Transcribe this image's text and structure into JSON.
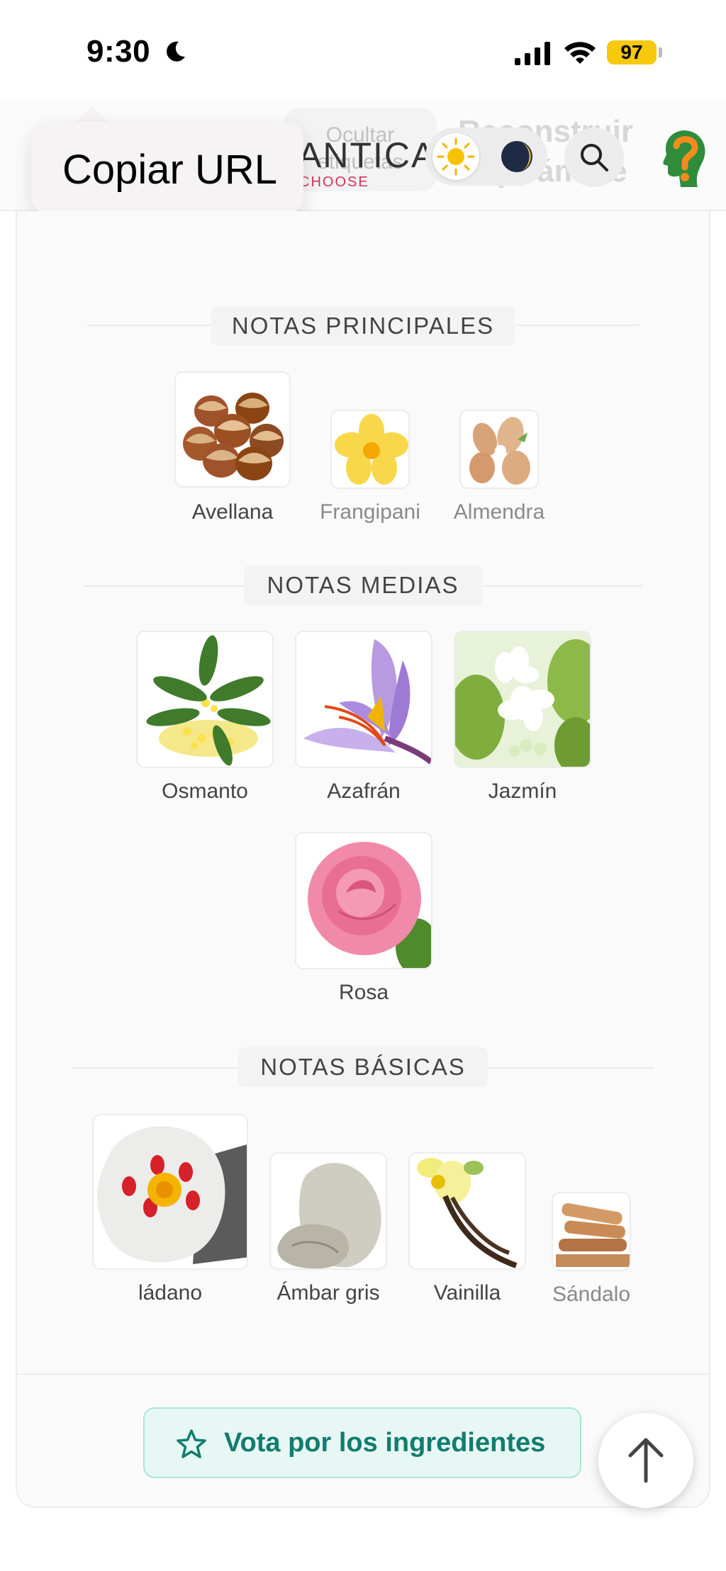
{
  "status_bar": {
    "time": "9:30",
    "battery": "97"
  },
  "header": {
    "hidden_button": {
      "line1": "Ocultar",
      "line2": "etiquetas"
    },
    "logo": {
      "main": "ANTICA",
      "sub": "CHOOSE"
    },
    "rebuild": {
      "line1": "Reconstruir",
      "line2": "la pirámide"
    }
  },
  "tooltip": {
    "label": "Copiar URL"
  },
  "sections": {
    "top": {
      "title": "NOTAS PRINCIPALES",
      "notes": [
        "Avellana",
        "Frangipani",
        "Almendra"
      ]
    },
    "middle": {
      "title": "NOTAS MEDIAS",
      "notes": [
        "Osmanto",
        "Azafrán",
        "Jazmín",
        "Rosa"
      ]
    },
    "base": {
      "title": "NOTAS BÁSICAS",
      "notes": [
        "ládano",
        "Ámbar gris",
        "Vainilla",
        "Sándalo"
      ]
    }
  },
  "vote_button": {
    "label": "Vota por los ingredientes"
  },
  "colors": {
    "accent_teal": "#127c6f",
    "vote_bg": "#e6f7f4",
    "battery": "#f7c90c",
    "logo_sub": "#d2335b"
  },
  "icons": {
    "moon": "moon-icon",
    "signal": "signal-icon",
    "wifi": "wifi-icon",
    "sun": "sun-icon",
    "dark": "dark-mode-icon",
    "search": "search-icon",
    "help": "help-icon",
    "star": "star-icon",
    "arrow_up": "arrow-up-icon"
  }
}
